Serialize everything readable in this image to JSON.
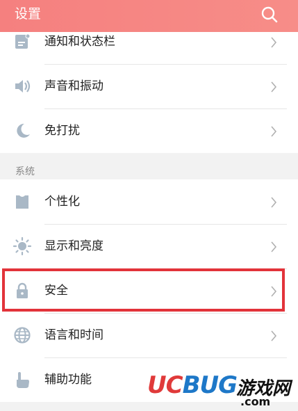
{
  "header": {
    "title": "设置"
  },
  "group1": {
    "items": [
      {
        "label": "通知和状态栏",
        "icon": "notification-icon"
      },
      {
        "label": "声音和振动",
        "icon": "speaker-icon"
      },
      {
        "label": "免打扰",
        "icon": "moon-icon"
      }
    ]
  },
  "section": {
    "label": "系统"
  },
  "group2": {
    "items": [
      {
        "label": "个性化",
        "icon": "personalize-icon"
      },
      {
        "label": "显示和亮度",
        "icon": "brightness-icon"
      },
      {
        "label": "安全",
        "icon": "lock-icon"
      },
      {
        "label": "语言和时间",
        "icon": "globe-icon"
      },
      {
        "label": "辅助功能",
        "icon": "hand-icon"
      }
    ]
  },
  "watermark": {
    "brand_u": "U",
    "brand_c": "C",
    "brand_bug": "BUG",
    "cn": "游戏网",
    "com": ".com"
  },
  "colors": {
    "header": "#f5807f",
    "highlight": "#e2333a",
    "icon": "#a9b8c6"
  }
}
